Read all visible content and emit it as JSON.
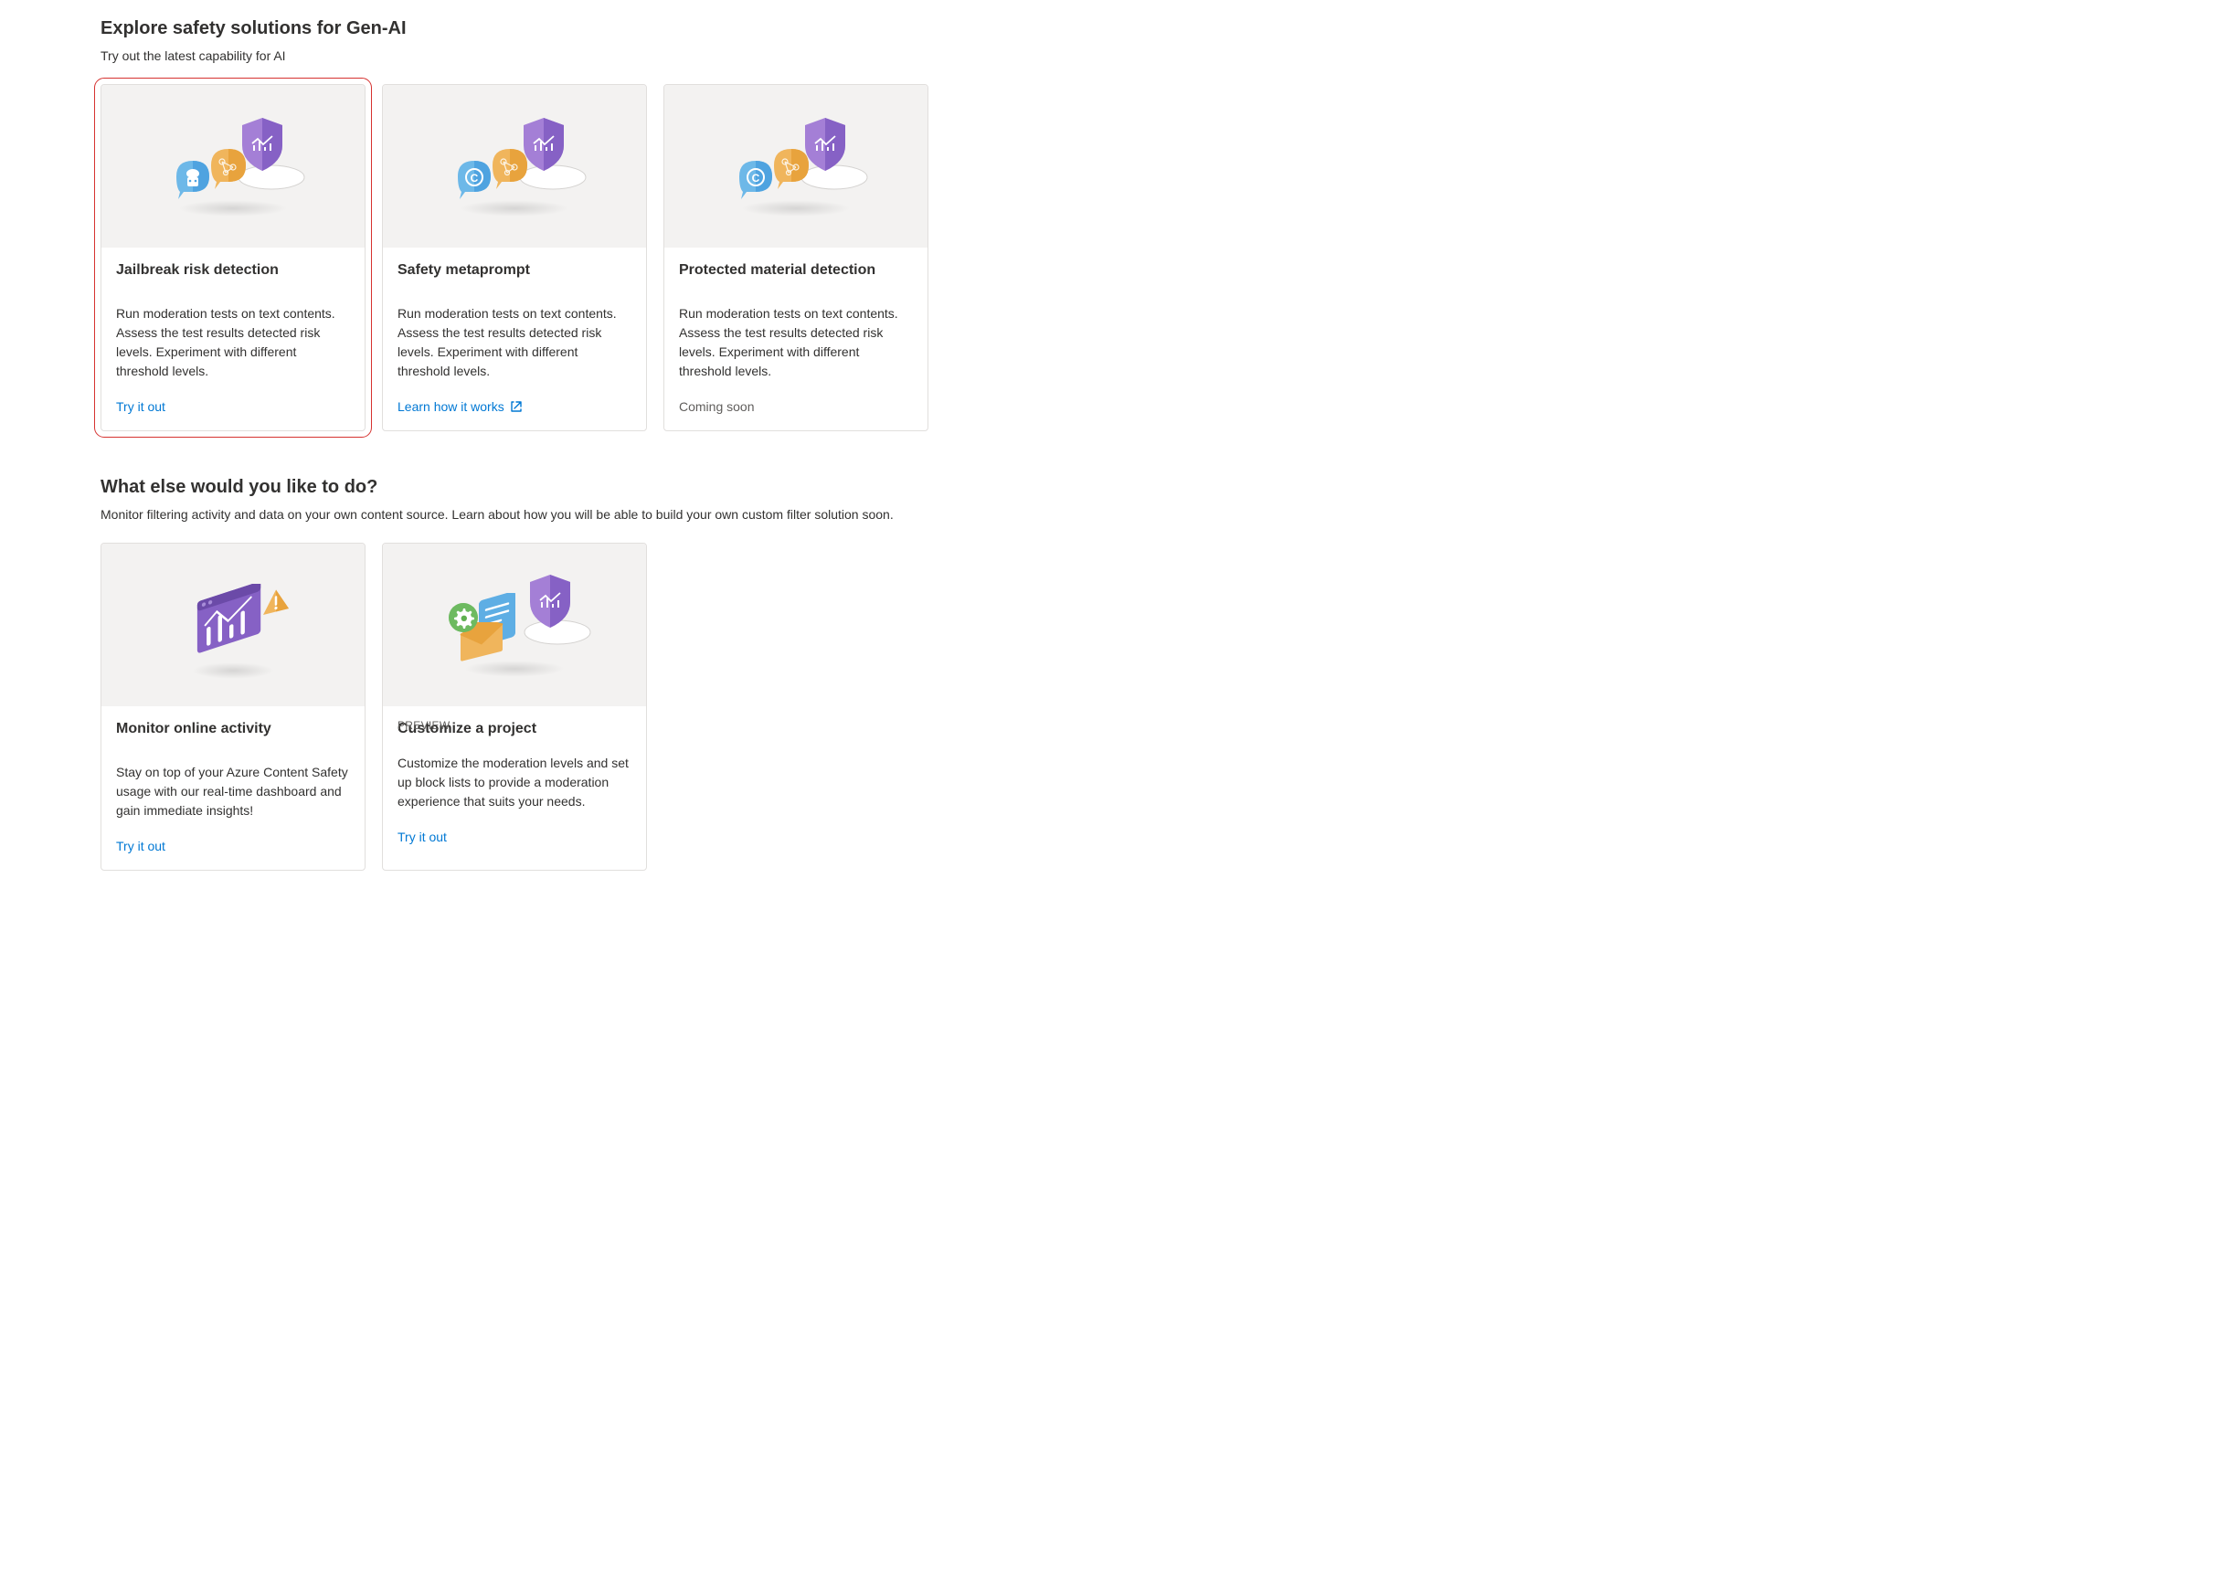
{
  "sections": {
    "explore": {
      "title": "Explore safety solutions for Gen-AI",
      "subtitle": "Try out the latest capability for AI",
      "cards": [
        {
          "title": "Jailbreak risk detection",
          "description": "Run moderation tests on text contents. Assess the test results detected risk levels. Experiment with different threshold levels.",
          "action_label": "Try it out",
          "action_type": "link",
          "highlighted": true,
          "icon_variant": "robot"
        },
        {
          "title": "Safety metaprompt",
          "description": "Run moderation tests on text contents. Assess the test results detected risk levels. Experiment with different threshold levels.",
          "action_label": "Learn how it works",
          "action_type": "external",
          "highlighted": false,
          "icon_variant": "copyright"
        },
        {
          "title": "Protected material detection",
          "description": "Run moderation tests on text contents. Assess the test results detected risk levels. Experiment with different threshold levels.",
          "action_label": "Coming soon",
          "action_type": "disabled",
          "highlighted": false,
          "icon_variant": "copyright"
        }
      ]
    },
    "more": {
      "title": "What else would you like to do?",
      "subtitle": "Monitor filtering activity and data on your own content source. Learn about how you will be able to build your own custom filter solution soon.",
      "cards": [
        {
          "title": "Monitor online activity",
          "badge": "",
          "description": "Stay on top of your Azure Content Safety usage with our real-time dashboard and gain immediate insights!",
          "action_label": "Try it out",
          "action_type": "link",
          "icon_variant": "monitor"
        },
        {
          "title": "Customize a project",
          "badge": "PREVIEW",
          "description": "Customize the moderation levels and set up block lists to provide a moderation experience that suits your needs.",
          "action_label": "Try it out",
          "action_type": "link",
          "icon_variant": "customize"
        }
      ]
    }
  },
  "colors": {
    "link": "#0078d4",
    "purple": "#8661c5",
    "orange": "#e8a33d",
    "blue": "#4fa3e0",
    "green": "#5fb04f"
  }
}
